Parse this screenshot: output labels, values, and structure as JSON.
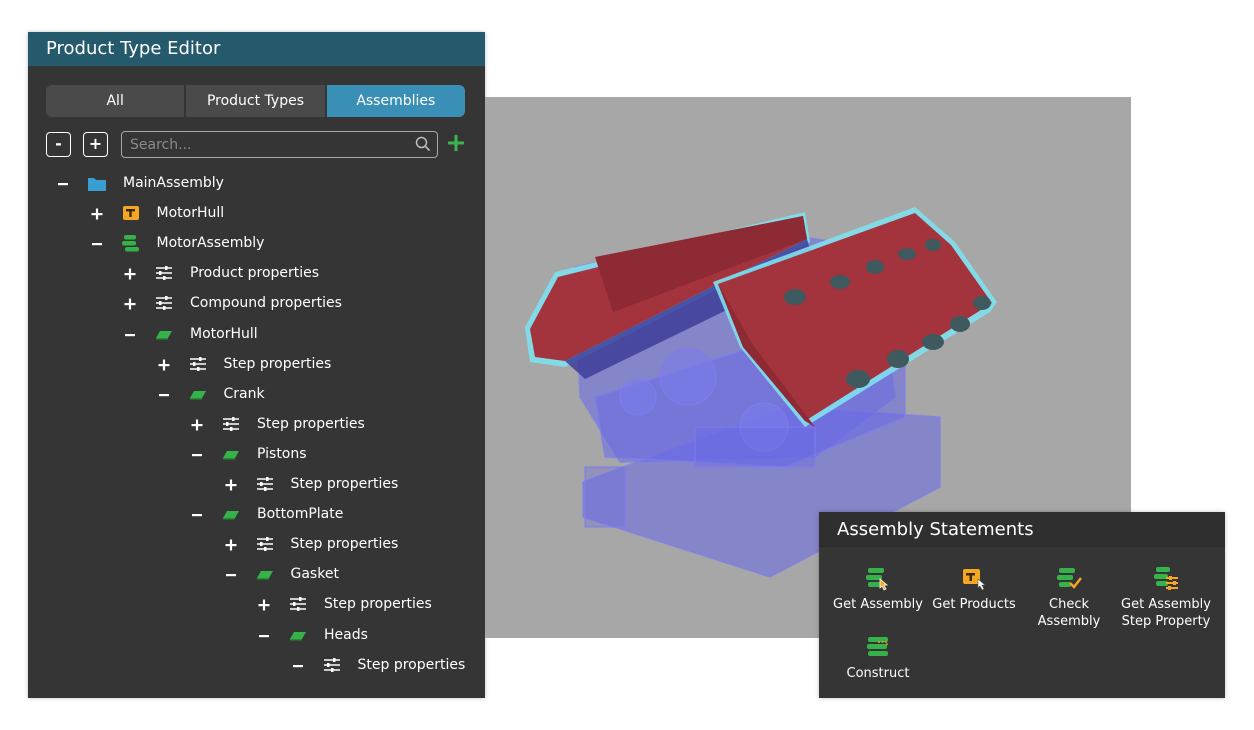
{
  "editor": {
    "title": "Product Type Editor",
    "tabs": [
      {
        "label": "All",
        "active": false
      },
      {
        "label": "Product Types",
        "active": false
      },
      {
        "label": "Assemblies",
        "active": true
      }
    ],
    "collapse_label": "-",
    "expand_label": "+",
    "search_placeholder": "Search...",
    "tree": [
      {
        "label": "MainAssembly",
        "toggle": "minus",
        "icon": "folder-icon",
        "level": 0
      },
      {
        "label": "MotorHull",
        "toggle": "plus",
        "icon": "product-type-icon",
        "level": 1
      },
      {
        "label": "MotorAssembly",
        "toggle": "minus",
        "icon": "assembly-icon",
        "level": 1
      },
      {
        "label": "Product properties",
        "toggle": "plus",
        "icon": "properties-icon",
        "level": 2
      },
      {
        "label": "Compound properties",
        "toggle": "plus",
        "icon": "properties-icon",
        "level": 2
      },
      {
        "label": "MotorHull",
        "toggle": "minus",
        "icon": "step-icon",
        "level": 2
      },
      {
        "label": "Step properties",
        "toggle": "plus",
        "icon": "properties-icon",
        "level": 3
      },
      {
        "label": "Crank",
        "toggle": "minus",
        "icon": "step-icon",
        "level": 3
      },
      {
        "label": "Step properties",
        "toggle": "plus",
        "icon": "properties-icon",
        "level": 4
      },
      {
        "label": "Pistons",
        "toggle": "minus",
        "icon": "step-icon",
        "level": 4
      },
      {
        "label": "Step properties",
        "toggle": "plus",
        "icon": "properties-icon",
        "level": 5
      },
      {
        "label": "BottomPlate",
        "toggle": "minus",
        "icon": "step-icon",
        "level": 4
      },
      {
        "label": "Step properties",
        "toggle": "plus",
        "icon": "properties-icon",
        "level": 5
      },
      {
        "label": "Gasket",
        "toggle": "minus",
        "icon": "step-icon",
        "level": 5
      },
      {
        "label": "Step properties",
        "toggle": "plus",
        "icon": "properties-icon",
        "level": 6
      },
      {
        "label": "Heads",
        "toggle": "minus",
        "icon": "step-icon",
        "level": 6
      },
      {
        "label": "Step properties",
        "toggle": "minus",
        "icon": "properties-icon",
        "level": 7
      }
    ]
  },
  "statements": {
    "title": "Assembly Statements",
    "items": [
      {
        "label": "Get Assembly",
        "icon": "get-assembly-icon"
      },
      {
        "label": "Get Products",
        "icon": "get-products-icon"
      },
      {
        "label": "Check\nAssembly",
        "icon": "check-assembly-icon"
      },
      {
        "label": "Get Assembly\nStep Property",
        "icon": "get-assembly-step-property-icon"
      },
      {
        "label": "Construct",
        "icon": "construct-icon"
      }
    ]
  },
  "colors": {
    "accent": "#3a8fb6",
    "title_bar": "#255a6c",
    "panel": "#353535",
    "assembly_green": "#36b24a",
    "product_orange": "#f5a623",
    "part_red": "#a3333d",
    "part_blue": "#6a6ae6",
    "highlight": "#7fe0ee"
  }
}
